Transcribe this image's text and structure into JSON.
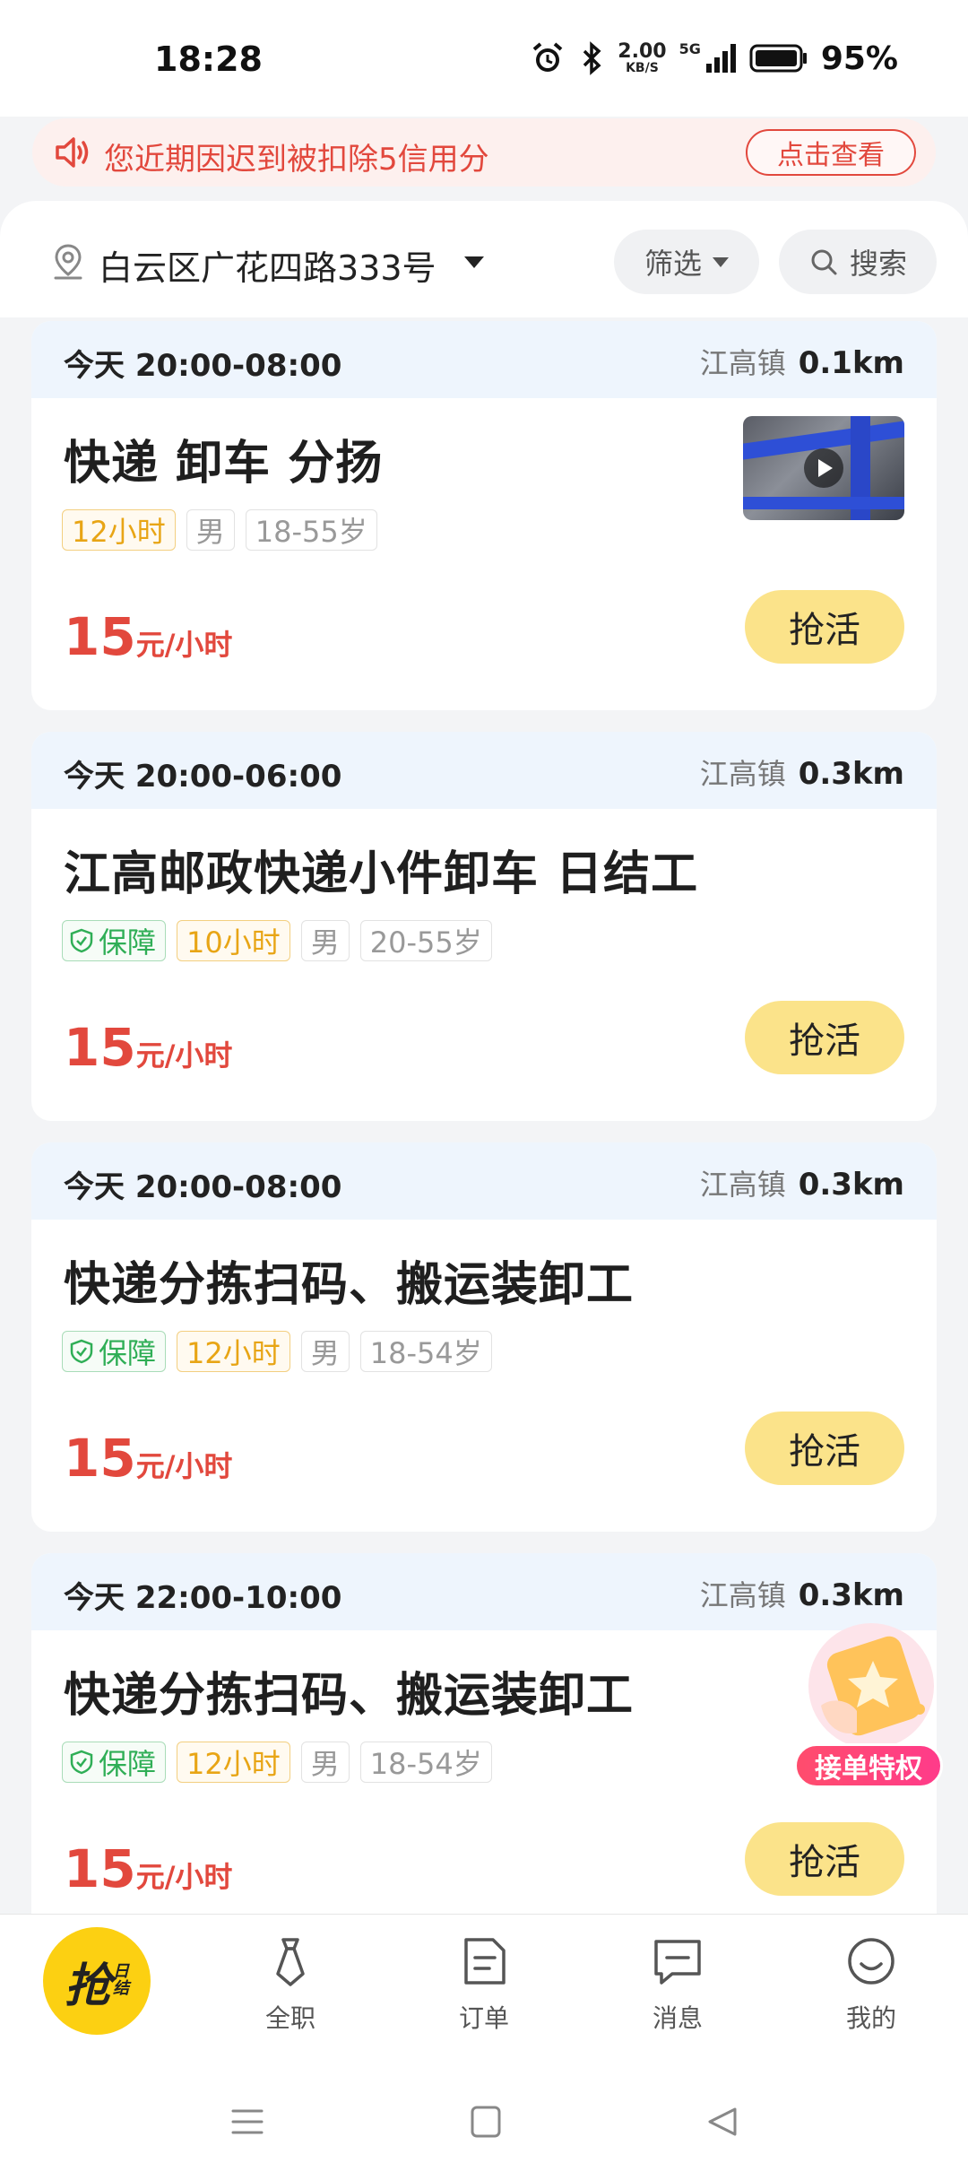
{
  "status_bar": {
    "time": "18:28",
    "net_speed_value": "2.00",
    "net_speed_unit": "KB/S",
    "signal_label": "5G",
    "battery_percent": "95%"
  },
  "notice": {
    "text": "您近期因迟到被扣除5信用分",
    "button_label": "点击查看"
  },
  "filter_bar": {
    "location": "白云区广花四路333号",
    "filter_label": "筛选",
    "search_label": "搜索"
  },
  "jobs": [
    {
      "time": "今天 20:00-08:00",
      "town": "江高镇",
      "distance": "0.1km",
      "title": "快递 卸车 分扬",
      "tags": [
        "12小时",
        "男",
        "18-55岁"
      ],
      "price": "15",
      "price_unit": "元/小时",
      "button": "抢活"
    },
    {
      "time": "今天 20:00-06:00",
      "town": "江高镇",
      "distance": "0.3km",
      "title": "江高邮政快递小件卸车 日结工",
      "guarantee": "保障",
      "tags": [
        "10小时",
        "男",
        "20-55岁"
      ],
      "price": "15",
      "price_unit": "元/小时",
      "button": "抢活"
    },
    {
      "time": "今天 20:00-08:00",
      "town": "江高镇",
      "distance": "0.3km",
      "title": "快递分拣扫码、搬运装卸工",
      "guarantee": "保障",
      "tags": [
        "12小时",
        "男",
        "18-54岁"
      ],
      "price": "15",
      "price_unit": "元/小时",
      "button": "抢活"
    },
    {
      "time": "今天 22:00-10:00",
      "town": "江高镇",
      "distance": "0.3km",
      "title": "快递分拣扫码、搬运装卸工",
      "guarantee": "保障",
      "tags": [
        "12小时",
        "男",
        "18-54岁"
      ],
      "price": "15",
      "price_unit": "元/小时",
      "button": "抢活"
    }
  ],
  "float_badge": {
    "label": "接单特权"
  },
  "bottom_nav": {
    "home_main": "抢",
    "home_sub_1": "日",
    "home_sub_2": "结",
    "items": [
      {
        "label": "全职",
        "icon": "tie-icon"
      },
      {
        "label": "订单",
        "icon": "document-icon"
      },
      {
        "label": "消息",
        "icon": "chat-icon"
      },
      {
        "label": "我的",
        "icon": "smile-icon"
      }
    ]
  },
  "colors": {
    "accent_red": "#e2483d",
    "accent_yellow": "#fcd012",
    "button_yellow": "#fbe38a",
    "tag_orange": "#e8a515",
    "tag_green": "#2fae56",
    "card_header_blue": "#eef5fd"
  }
}
